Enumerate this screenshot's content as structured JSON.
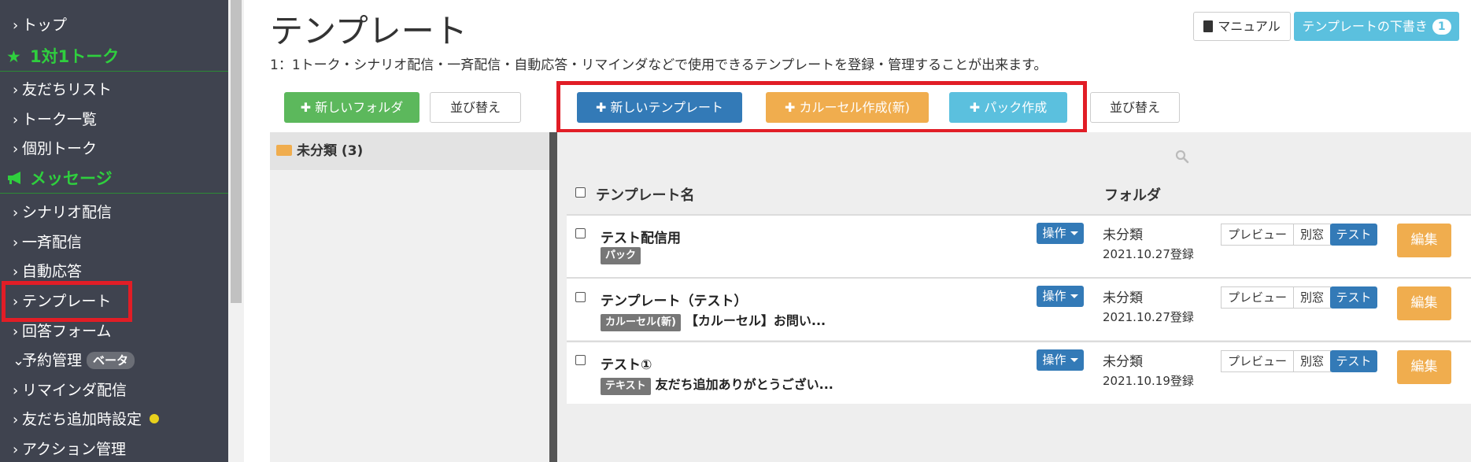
{
  "sidebar": {
    "items": [
      {
        "label": "トップ"
      },
      {
        "label": "友だちリスト"
      },
      {
        "label": "トーク一覧"
      },
      {
        "label": "個別トーク"
      },
      {
        "label": "シナリオ配信"
      },
      {
        "label": "一斉配信"
      },
      {
        "label": "自動応答"
      },
      {
        "label": "テンプレート"
      },
      {
        "label": "回答フォーム"
      },
      {
        "label": "予約管理"
      },
      {
        "label": "リマインダ配信"
      },
      {
        "label": "友だち追加時設定"
      },
      {
        "label": "アクション管理"
      }
    ],
    "sections": [
      {
        "label": "1対1トーク",
        "icon": "star-icon"
      },
      {
        "label": "メッセージ",
        "icon": "megaphone-icon"
      }
    ],
    "beta_badge": "ベータ",
    "active_item": "テンプレート",
    "section_color": "#2fcf3e",
    "highlight_color": "#e11d26"
  },
  "header": {
    "title": "テンプレート",
    "subtitle": "1：1トーク・シナリオ配信・一斉配信・自動応答・リマインダなどで使用できるテンプレートを登録・管理することが出来ます。",
    "manual_label": "マニュアル",
    "drafts_label": "テンプレートの下書き",
    "drafts_count": "1"
  },
  "toolbar": {
    "new_folder": "新しいフォルダ",
    "sort_folders": "並び替え",
    "new_template": "新しいテンプレート",
    "carousel": "カルーセル作成(新)",
    "pack": "パック作成",
    "sort_templates": "並び替え"
  },
  "folders": {
    "items": [
      {
        "label": "未分類 (3)"
      }
    ]
  },
  "table": {
    "headers": {
      "name": "テンプレート名",
      "folder": "フォルダ"
    },
    "op_label": "操作",
    "preview_label": "プレビュー",
    "window_label": "別窓",
    "test_label": "テスト",
    "edit_label": "編集",
    "rows": [
      {
        "name": "テスト配信用",
        "tag": "パック",
        "preview": "",
        "folder": "未分類",
        "date": "2021.10.27登録"
      },
      {
        "name": "テンプレート（テスト）",
        "tag": "カルーセル(新)",
        "preview": "【カルーセル】お問い...",
        "folder": "未分類",
        "date": "2021.10.27登録"
      },
      {
        "name": "テスト①",
        "tag": "テキスト",
        "preview": "友だち追加ありがとうござい...",
        "folder": "未分類",
        "date": "2021.10.19登録"
      }
    ]
  }
}
